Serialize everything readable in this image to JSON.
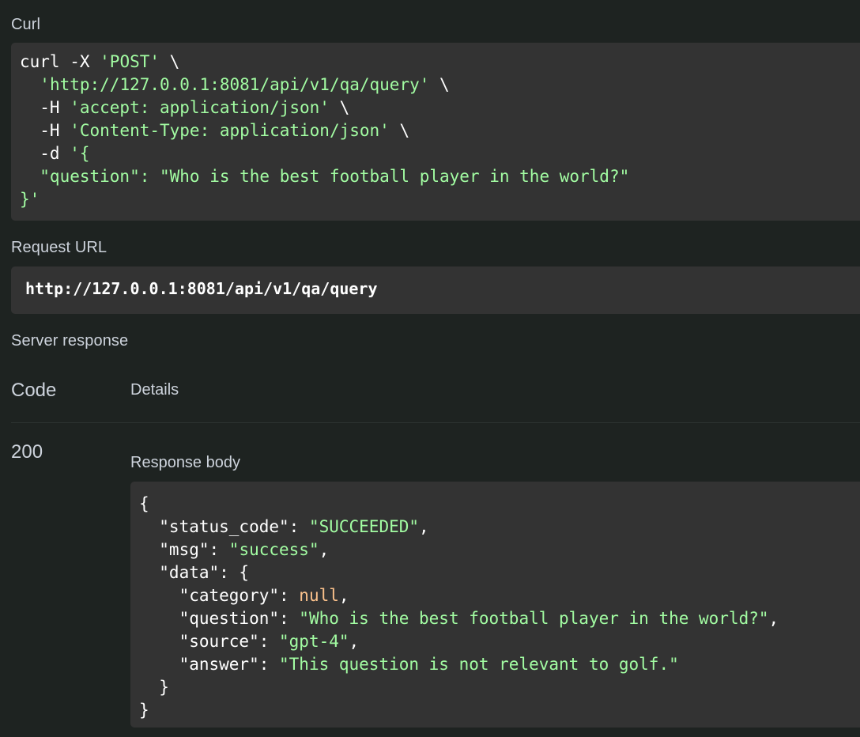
{
  "curl": {
    "label": "Curl",
    "lines": [
      [
        {
          "t": "plain",
          "v": "curl -X "
        },
        {
          "t": "str",
          "v": "'POST'"
        },
        {
          "t": "plain",
          "v": " \\"
        }
      ],
      [
        {
          "t": "plain",
          "v": "  "
        },
        {
          "t": "str",
          "v": "'http://127.0.0.1:8081/api/v1/qa/query'"
        },
        {
          "t": "plain",
          "v": " \\"
        }
      ],
      [
        {
          "t": "plain",
          "v": "  -H "
        },
        {
          "t": "str",
          "v": "'accept: application/json'"
        },
        {
          "t": "plain",
          "v": " \\"
        }
      ],
      [
        {
          "t": "plain",
          "v": "  -H "
        },
        {
          "t": "str",
          "v": "'Content-Type: application/json'"
        },
        {
          "t": "plain",
          "v": " \\"
        }
      ],
      [
        {
          "t": "plain",
          "v": "  -d "
        },
        {
          "t": "str",
          "v": "'{"
        }
      ],
      [
        {
          "t": "str",
          "v": "  \"question\": \"Who is the best football player in the world?\""
        }
      ],
      [
        {
          "t": "str",
          "v": "}'"
        }
      ]
    ]
  },
  "request_url": {
    "label": "Request URL",
    "value": "http://127.0.0.1:8081/api/v1/qa/query"
  },
  "server_response": {
    "label": "Server response",
    "col_code": "Code",
    "col_details": "Details",
    "status_code": "200",
    "response_body_label": "Response body",
    "body_lines": [
      [
        {
          "t": "plain",
          "v": "{"
        }
      ],
      [
        {
          "t": "plain",
          "v": "  \"status_code\": "
        },
        {
          "t": "str",
          "v": "\"SUCCEEDED\""
        },
        {
          "t": "plain",
          "v": ","
        }
      ],
      [
        {
          "t": "plain",
          "v": "  \"msg\": "
        },
        {
          "t": "str",
          "v": "\"success\""
        },
        {
          "t": "plain",
          "v": ","
        }
      ],
      [
        {
          "t": "plain",
          "v": "  \"data\": {"
        }
      ],
      [
        {
          "t": "plain",
          "v": "    \"category\": "
        },
        {
          "t": "null",
          "v": "null"
        },
        {
          "t": "plain",
          "v": ","
        }
      ],
      [
        {
          "t": "plain",
          "v": "    \"question\": "
        },
        {
          "t": "str",
          "v": "\"Who is the best football player in the world?\""
        },
        {
          "t": "plain",
          "v": ","
        }
      ],
      [
        {
          "t": "plain",
          "v": "    \"source\": "
        },
        {
          "t": "str",
          "v": "\"gpt-4\""
        },
        {
          "t": "plain",
          "v": ","
        }
      ],
      [
        {
          "t": "plain",
          "v": "    \"answer\": "
        },
        {
          "t": "str",
          "v": "\"This question is not relevant to golf.\""
        }
      ],
      [
        {
          "t": "plain",
          "v": "  }"
        }
      ],
      [
        {
          "t": "plain",
          "v": "}"
        }
      ]
    ]
  },
  "colors": {
    "background": "#1e2321",
    "code_bg": "#333333",
    "string": "#a2fca2",
    "null": "#fcc28c",
    "label": "#cdd3dc"
  }
}
